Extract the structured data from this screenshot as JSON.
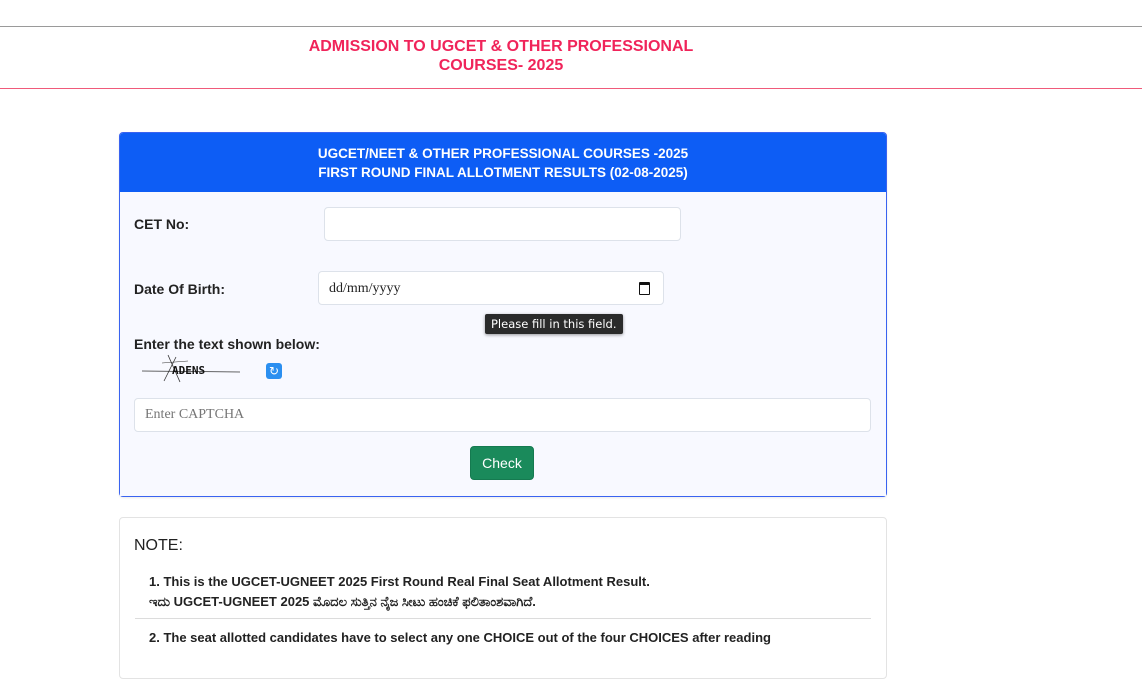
{
  "header": {
    "line1": "ADMISSION TO UGCET & OTHER PROFESSIONAL",
    "line2": "COURSES- 2025"
  },
  "card": {
    "title_line1": "UGCET/NEET & OTHER PROFESSIONAL COURSES -2025",
    "title_line2": "FIRST ROUND FINAL ALLOTMENT RESULTS (02-08-2025)"
  },
  "form": {
    "cet_label": "CET No:",
    "cet_value": "",
    "dob_label": "Date Of Birth:",
    "dob_placeholder": "dd/mm/yyyy",
    "tooltip": "Please fill in this field.",
    "captcha_label": "Enter the text shown below:",
    "captcha_text": "ADENS",
    "captcha_placeholder": "Enter CAPTCHA",
    "check_label": "Check"
  },
  "note": {
    "title": "NOTE:",
    "item1_en": "1. This is the UGCET-UGNEET 2025 First Round Real Final Seat Allotment Result.",
    "item1_kn": "ಇದು UGCET-UGNEET 2025 ಮೊದಲ ಸುತ್ತಿನ ನೈಜ ಸೀಟು ಹಂಚಿಕೆ ಫಲಿತಾಂಶವಾಗಿದೆ.",
    "item2": "2. The seat allotted candidates have to select any one CHOICE out of the four CHOICES after reading"
  },
  "colors": {
    "header_text": "#f0245a",
    "card_header_bg": "#0d5df5",
    "check_button_bg": "#1a8a5b"
  }
}
